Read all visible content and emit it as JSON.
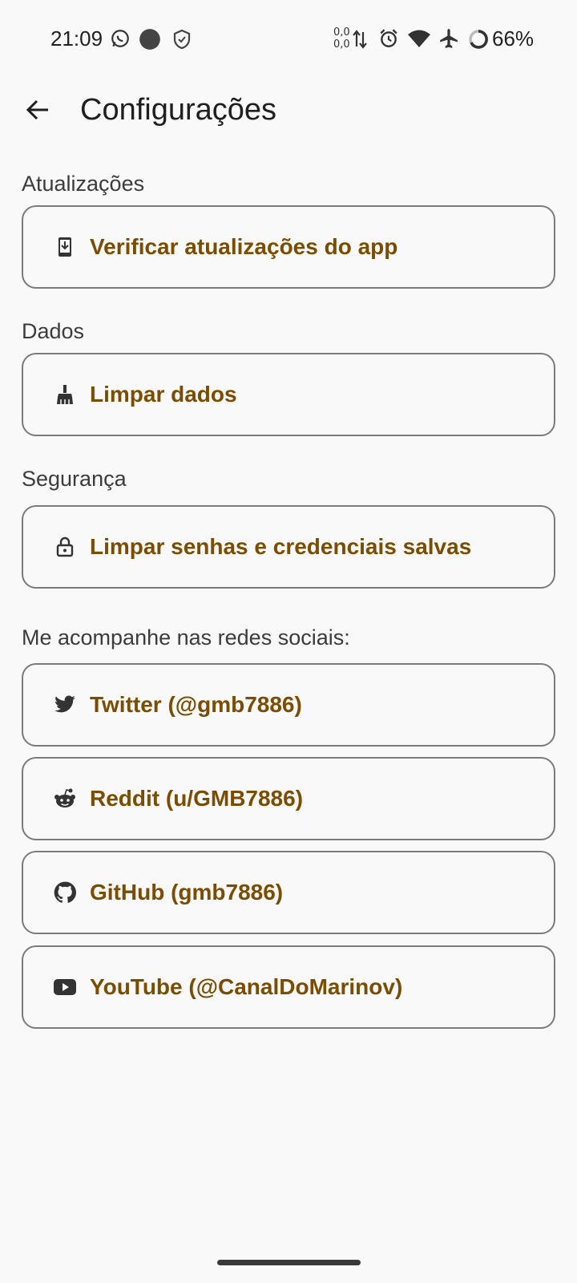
{
  "status_bar": {
    "time": "21:09",
    "net_up": "0,0",
    "net_down": "0,0",
    "battery": "66%",
    "icons": [
      "whatsapp-icon",
      "dot-icon",
      "shield-icon",
      "data-arrows-icon",
      "alarm-icon",
      "wifi-icon",
      "airplane-icon",
      "battery-ring-icon"
    ]
  },
  "app_bar": {
    "back_icon": "arrow-back-icon",
    "title": "Configurações"
  },
  "sections": {
    "updates": {
      "label": "Atualizações",
      "item": {
        "label": "Verificar atualizações do app",
        "icon": "system-update-icon"
      }
    },
    "data": {
      "label": "Dados",
      "item": {
        "label": "Limpar dados",
        "icon": "broom-icon"
      }
    },
    "security": {
      "label": "Segurança",
      "item": {
        "label": "Limpar senhas e credenciais salvas",
        "icon": "lock-icon"
      }
    },
    "social": {
      "label": "Me acompanhe nas redes sociais:",
      "items": [
        {
          "label": "Twitter (@gmb7886)",
          "icon": "twitter-icon"
        },
        {
          "label": "Reddit (u/GMB7886)",
          "icon": "reddit-icon"
        },
        {
          "label": "GitHub (gmb7886)",
          "icon": "github-icon"
        },
        {
          "label": "YouTube (@CanalDoMarinov)",
          "icon": "youtube-icon"
        }
      ]
    }
  },
  "colors": {
    "accent": "#7a4d00",
    "background": "#f9f9f9",
    "card_border": "#7b7b7b"
  }
}
